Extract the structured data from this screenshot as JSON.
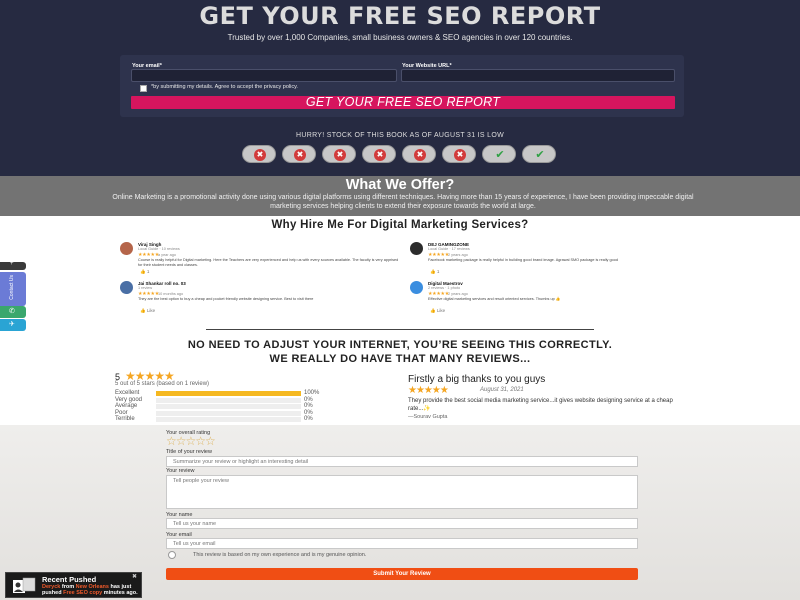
{
  "hero": {
    "title": "GET YOUR FREE SEO REPORT",
    "subtitle": "Trusted by over 1,000 Companies, small business owners & SEO agencies in over 120 countries.",
    "email_label": "Your email*",
    "website_label": "Your Website URL*",
    "consent_text": "*by submitting my details. Agree to accept the privacy policy.",
    "cta_label": "GET YOUR FREE SEO REPORT",
    "hurry_text": "HURRY! STOCK OF THIS BOOK AS OF AUGUST 31 IS LOW",
    "stock": [
      "x",
      "x",
      "x",
      "x",
      "x",
      "x",
      "check",
      "check"
    ]
  },
  "offer": {
    "title": "What We Offer?",
    "text": "Online Marketing is a promotional activity done using various digital platforms using different techniques. Having more than 15 years of experience, I have been providing impeccable digital marketing services helping clients to extend their exposure towards the world at large."
  },
  "why": {
    "title": "Why Hire Me For Digital Marketing Services?",
    "reviews": [
      {
        "name": "Viraj Singh",
        "meta": "Local Guide · 10 reviews",
        "stars": "★★★★★",
        "time": "a year ago",
        "text": "Course is really helpful for Digital marketing. Here the Teachers are very experienced and help us with every sources available. The faculty is very apprised for their student needs and classes.",
        "like": "👍 1",
        "avatar_color": "#b5654a"
      },
      {
        "name": "DEJ GAMINGZONE",
        "meta": "Local Guide · 17 reviews",
        "stars": "★★★★★",
        "time": "2 years ago",
        "text": "Facebook marketing package is really helpful in building good brand image. Agrawal SMO package is really good",
        "like": "👍 1",
        "avatar_color": "#2c2c2c"
      },
      {
        "name": "Jai Shankar roll no. 03",
        "meta": "1 review",
        "stars": "★★★★★",
        "time": "10 months ago",
        "text": "They are the best option to buy a cheap and pocket friendly website designing service. Best to visit there",
        "like": "👍 Like",
        "avatar_color": "#4a6fa5"
      },
      {
        "name": "Digital Maestrov",
        "meta": "2 reviews · 1 photo",
        "stars": "★★★★★",
        "time": "2 years ago",
        "text": "Effective digital marketing services and result oriented services. Thumbs up 👍",
        "like": "👍 Like",
        "avatar_color": "#3b8ee0"
      }
    ]
  },
  "sidebar": {
    "tab_label": "Contact Us"
  },
  "reviews": {
    "heading_1": "NO NEED TO ADJUST YOUR INTERNET, YOU’RE SEEING THIS CORRECTLY.",
    "heading_2": "WE REALLY DO HAVE THAT MANY REVIEWS...",
    "score": "5",
    "score_stars": "★★★★★",
    "score_sub": "5 out of 5 stars (based on 1 review)",
    "bars": [
      {
        "label": "Excellent",
        "pct": "100%",
        "value": 1.0
      },
      {
        "label": "Very good",
        "pct": "0%",
        "value": 0
      },
      {
        "label": "Average",
        "pct": "0%",
        "value": 0
      },
      {
        "label": "Poor",
        "pct": "0%",
        "value": 0
      },
      {
        "label": "Terrible",
        "pct": "0%",
        "value": 0
      }
    ],
    "testimonial_title": "Firstly a big thanks to you guys",
    "testimonial_stars": "★★★★★",
    "testimonial_date": "August 31, 2021",
    "testimonial_text": "They provide the best social media marketing service...it gives website designing service at a cheap rate...✨",
    "testimonial_author": "—Sourav Gupta"
  },
  "review_form": {
    "rating_label": "Your overall rating",
    "rating_stars": "☆☆☆☆☆",
    "title_label": "Title of your review",
    "title_placeholder": "Summarize your review or highlight an interesting detail",
    "review_label": "Your review",
    "review_placeholder": "Tell people your review",
    "name_label": "Your name",
    "name_placeholder": "Tell us your name",
    "email_label": "Your email",
    "email_placeholder": "Tell us your email",
    "genuine_text": "This review is based on my own experience and is my genuine opinion.",
    "submit_label": "Submit Your Review"
  },
  "toast": {
    "title": "Recent Pushed",
    "close": "✖",
    "name": "Deryck",
    "from": " from ",
    "city": "New Orleans",
    "mid": " has just pushed ",
    "product": "Free SEO copy",
    "end": " minutes ago."
  }
}
